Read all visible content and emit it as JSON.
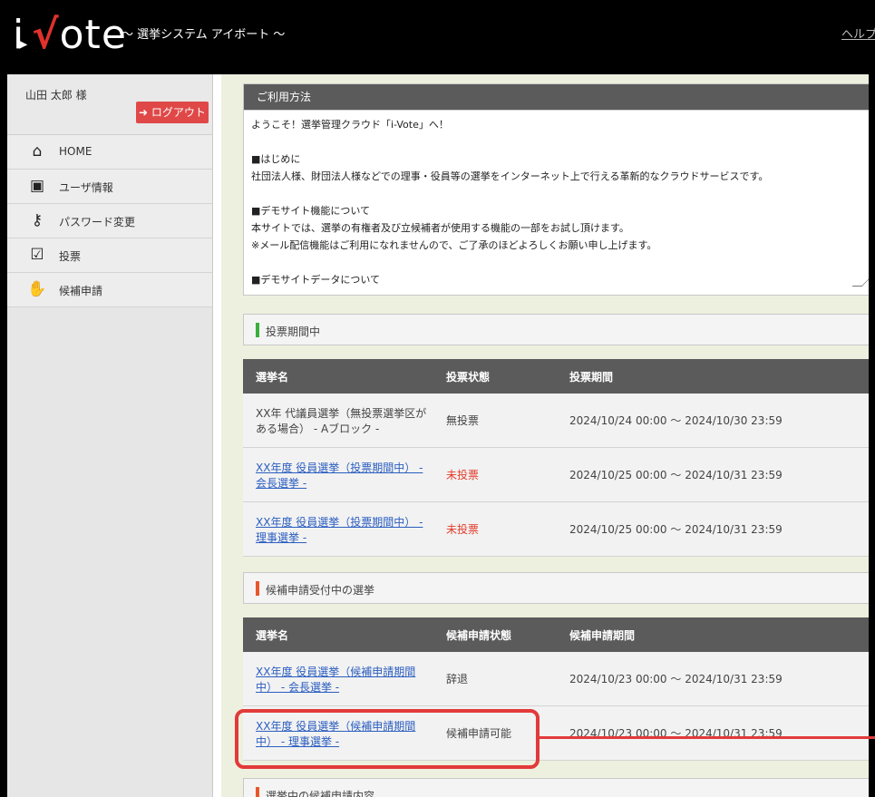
{
  "header": {
    "logo_prefix": "i",
    "logo_check": "√",
    "logo_suffix": "ote",
    "tagline": "～ 選挙システム アイボート ～",
    "help_link": "ヘルプ"
  },
  "sidebar": {
    "user_name": "山田 太郎 様",
    "logout_label": "ログアウト",
    "items": [
      {
        "label": "HOME",
        "icon": "home-icon"
      },
      {
        "label": "ユーザ情報",
        "icon": "id-card-icon"
      },
      {
        "label": "パスワード変更",
        "icon": "key-icon"
      },
      {
        "label": "投票",
        "icon": "ballot-box-icon"
      },
      {
        "label": "候補申請",
        "icon": "hand-icon"
      }
    ]
  },
  "usage": {
    "title": "ご利用方法",
    "lines": [
      "ようこそ！選挙管理クラウド「i-Vote」へ！",
      "",
      "■はじめに",
      "社団法人様、財団法人様などでの理事・役員等の選挙をインターネット上で行える革新的なクラウドサービスです。",
      "",
      "■デモサイト機能について",
      "本サイトでは、選挙の有権者及び立候補者が使用する機能の一部をお試し頂けます。",
      "※メール配信機能はご利用になれませんので、ご了承のほどよろしくお願い申し上げます。",
      "",
      "■デモサイトデータについて"
    ]
  },
  "voting": {
    "section_title": "投票期間中",
    "headers": {
      "name": "選挙名",
      "status": "投票状態",
      "period": "投票期間"
    },
    "rows": [
      {
        "name": "XX年 代議員選挙（無投票選挙区がある場合） - Aブロック -",
        "status": "無投票",
        "period": "2024/10/24 00:00 ～ 2024/10/30 23:59"
      },
      {
        "name": "XX年度 役員選挙（投票期間中） - 会長選挙 -",
        "status": "未投票",
        "period": "2024/10/25 00:00 ～ 2024/10/31 23:59"
      },
      {
        "name": "XX年度 役員選挙（投票期間中） - 理事選挙 -",
        "status": "未投票",
        "period": "2024/10/25 00:00 ～ 2024/10/31 23:59"
      }
    ]
  },
  "candidacy": {
    "section_title": "候補申請受付中の選挙",
    "headers": {
      "name": "選挙名",
      "status": "候補申請状態",
      "period": "候補申請期間"
    },
    "rows": [
      {
        "name": "XX年度 役員選挙（候補申請期間中） - 会長選挙 -",
        "status": "辞退",
        "period": "2024/10/23 00:00 ～ 2024/10/31 23:59"
      },
      {
        "name": "XX年度 役員選挙（候補申請期間中） - 理事選挙 -",
        "status": "候補申請可能",
        "period": "2024/10/23 00:00 ～ 2024/10/31 23:59"
      }
    ]
  },
  "content_section": {
    "section_title": "選挙中の候補申請内容"
  },
  "colors": {
    "accent_green": "#38b03a",
    "accent_orange": "#e8562a",
    "highlight_red": "#e23a3a",
    "link_blue": "#2b5ec0"
  }
}
